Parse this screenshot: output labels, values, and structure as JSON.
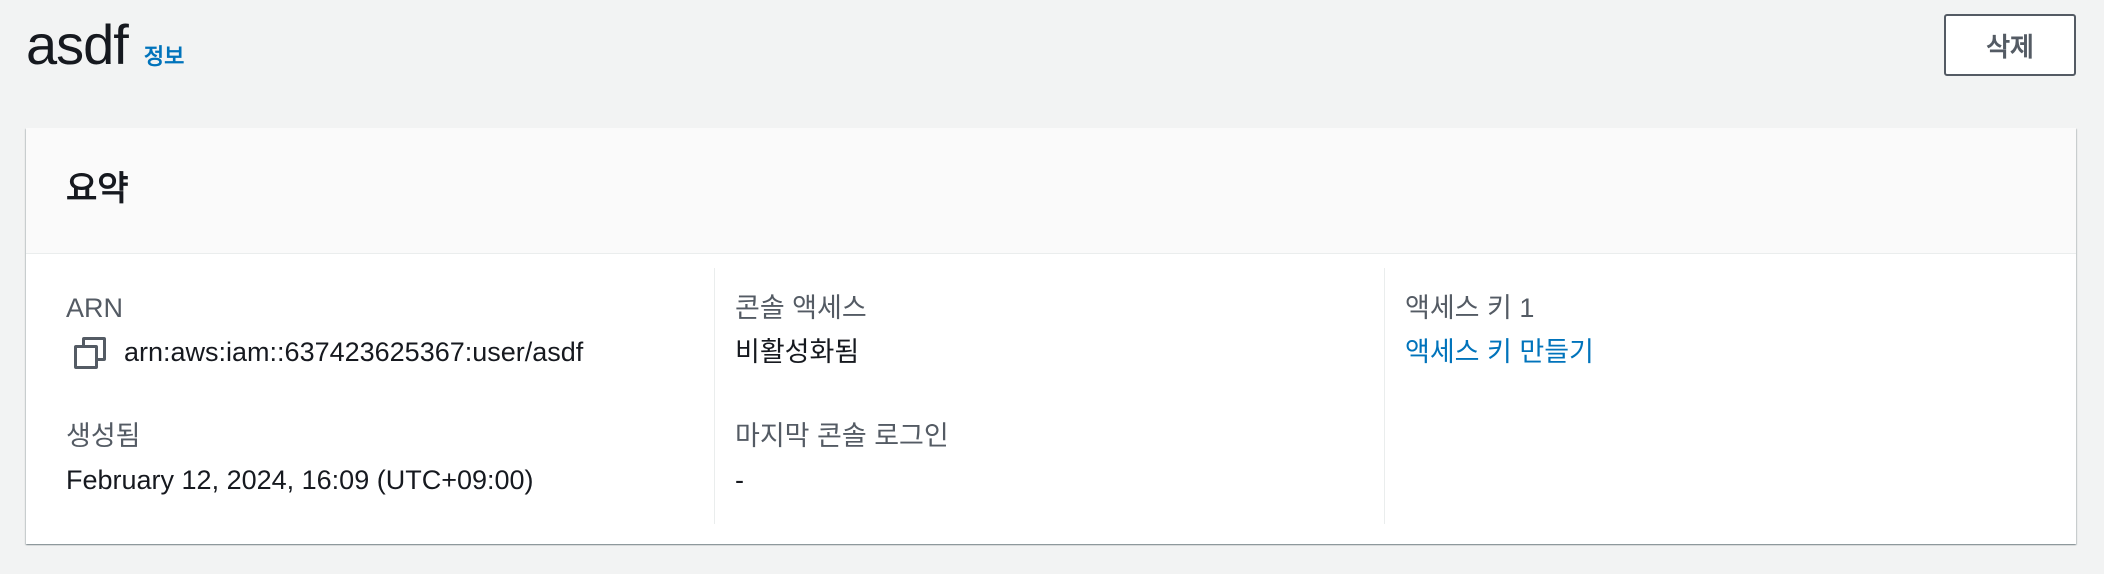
{
  "header": {
    "title": "asdf",
    "info_link": "정보",
    "delete_button": "삭제"
  },
  "summary": {
    "title": "요약",
    "arn": {
      "label": "ARN",
      "value": "arn:aws:iam::637423625367:user/asdf",
      "icon": "copy-icon"
    },
    "created": {
      "label": "생성됨",
      "value": "February 12, 2024, 16:09 (UTC+09:00)"
    },
    "console_access": {
      "label": "콘솔 액세스",
      "value": "비활성화됨"
    },
    "last_console_login": {
      "label": "마지막 콘솔 로그인",
      "value": "-"
    },
    "access_key_1": {
      "label": "액세스 키 1",
      "value": "액세스 키 만들기"
    }
  },
  "colors": {
    "link": "#0073bb",
    "text": "#16191f",
    "label": "#545b64",
    "background": "#f2f3f3"
  }
}
